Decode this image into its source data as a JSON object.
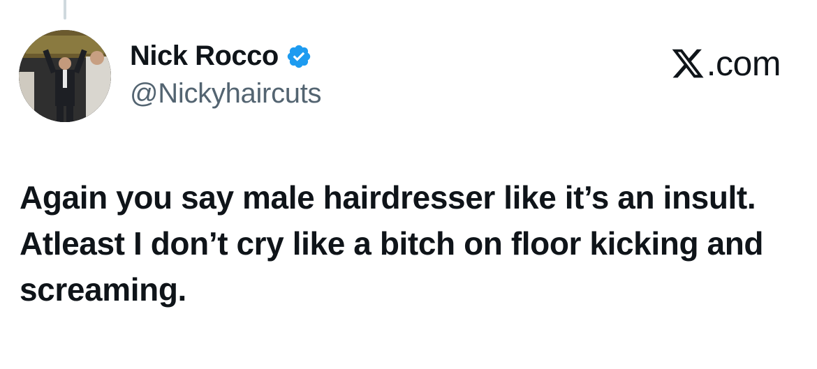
{
  "author": {
    "display_name": "Nick Rocco",
    "handle": "@Nickyhaircuts",
    "verified": true,
    "avatar": "profile-photo"
  },
  "site": {
    "label": ".com",
    "logo_icon": "x-logo-icon"
  },
  "tweet": {
    "text": "Again you say male hairdresser like it’s an insult. Atleast I don’t cry like a bitch on floor kicking and screaming."
  },
  "colors": {
    "text_primary": "#0f1419",
    "text_secondary": "#536471",
    "verified_blue": "#1d9bf0",
    "thread_line": "#cfd9de",
    "background": "#ffffff"
  }
}
